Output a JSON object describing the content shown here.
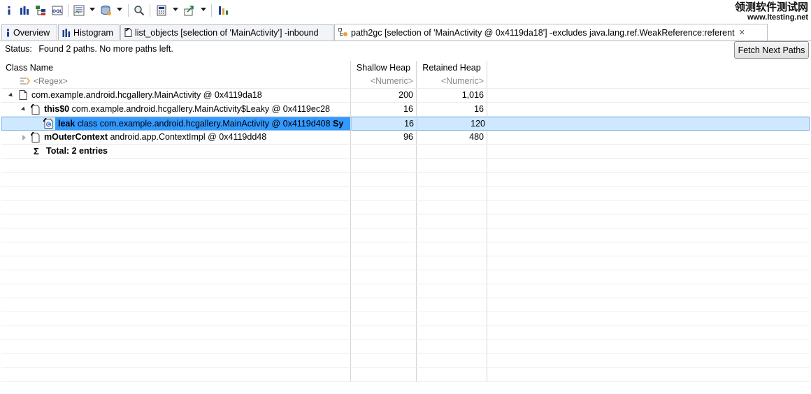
{
  "watermark": {
    "title": "领测软件测试网",
    "url": "www.ltesting.net"
  },
  "tabs": [
    {
      "label": "Overview",
      "icon": "info-icon"
    },
    {
      "label": "Histogram",
      "icon": "histogram-icon"
    },
    {
      "label": "list_objects [selection of 'MainActivity'] -inbound",
      "icon": "list-objects-icon"
    },
    {
      "label": "path2gc [selection of 'MainActivity @ 0x4119da18'] -excludes java.lang.ref.WeakReference:referent",
      "icon": "path2gc-icon",
      "active": true,
      "close": "✕"
    }
  ],
  "status": {
    "label": "Status:",
    "text": "Found 2 paths. No more paths left."
  },
  "fetch_button": "Fetch Next Paths",
  "table": {
    "columns": [
      "Class Name",
      "Shallow Heap",
      "Retained Heap"
    ],
    "filters": {
      "name": "<Regex>",
      "shallow": "<Numeric>",
      "retained": "<Numeric>"
    },
    "rows": [
      {
        "field": "",
        "text": "com.example.android.hcgallery.MainActivity @ 0x4119da18",
        "shallow": "200",
        "retained": "1,016"
      },
      {
        "field": "this$0",
        "text": "com.example.android.hcgallery.MainActivity$Leaky @ 0x4119ec28",
        "shallow": "16",
        "retained": "16"
      },
      {
        "field": "leak",
        "text": "class com.example.android.hcgallery.MainActivity @ 0x4119d408",
        "suffix": "Sy",
        "shallow": "16",
        "retained": "120"
      },
      {
        "field": "mOuterContext",
        "text": "android.app.ContextImpl @ 0x4119dd48",
        "shallow": "96",
        "retained": "480"
      }
    ],
    "total": {
      "symbol": "Σ",
      "text": "Total: 2 entries"
    }
  }
}
